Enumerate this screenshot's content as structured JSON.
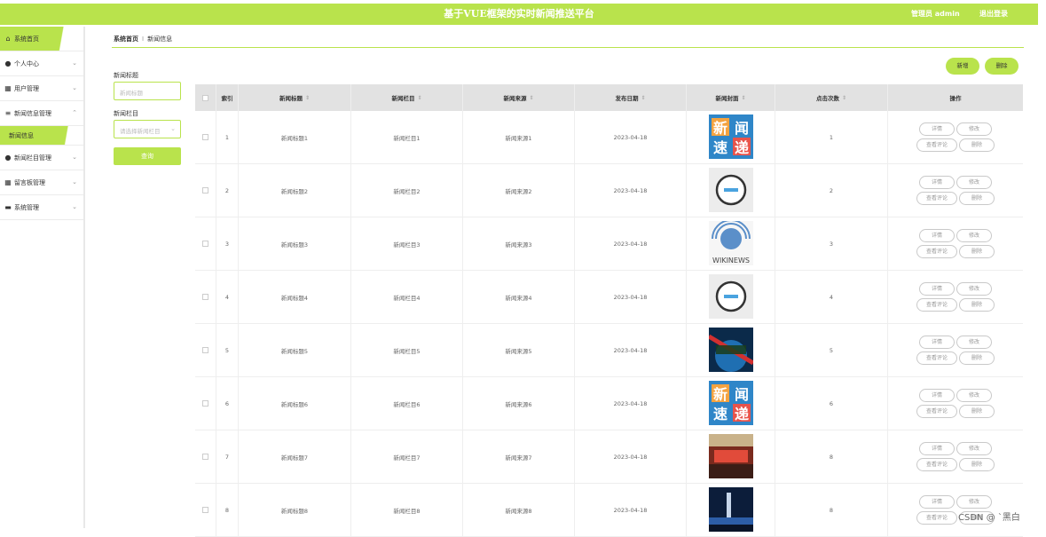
{
  "header": {
    "title": "基于VUE框架的实时新闻推送平台",
    "admin": "管理员 admin",
    "logout": "退出登录"
  },
  "sidebar": {
    "items": [
      {
        "label": "系统首页",
        "icon": "home-icon"
      },
      {
        "label": "个人中心",
        "icon": "user-icon"
      },
      {
        "label": "用户管理",
        "icon": "grid-icon"
      },
      {
        "label": "新闻信息管理",
        "icon": "list-icon"
      },
      {
        "label": "新闻信息",
        "icon": ""
      },
      {
        "label": "新闻栏目管理",
        "icon": "user-icon"
      },
      {
        "label": "留言板管理",
        "icon": "grid-icon"
      },
      {
        "label": "系统管理",
        "icon": "monitor-icon"
      }
    ]
  },
  "breadcrumb": {
    "home": "系统首页",
    "sep": "I",
    "current": "新闻信息"
  },
  "filter": {
    "title_label": "新闻标题",
    "title_placeholder": "新闻标题",
    "column_label": "新闻栏目",
    "column_placeholder": "请选择新闻栏目",
    "search_button": "查询"
  },
  "actions": {
    "add": "新增",
    "delete": "删除"
  },
  "table": {
    "headers": [
      "索引",
      "新闻标题",
      "新闻栏目",
      "新闻来源",
      "发布日期",
      "新闻封面",
      "点击次数",
      "操作"
    ],
    "rows": [
      {
        "idx": "1",
        "title": "新闻标题1",
        "column": "新闻栏目1",
        "source": "新闻来源1",
        "date": "2023-04-18",
        "clicks": "1",
        "cover": "news-flash"
      },
      {
        "idx": "2",
        "title": "新闻标题2",
        "column": "新闻栏目2",
        "source": "新闻来源2",
        "date": "2023-04-18",
        "clicks": "2",
        "cover": "circle-logo"
      },
      {
        "idx": "3",
        "title": "新闻标题3",
        "column": "新闻栏目3",
        "source": "新闻来源3",
        "date": "2023-04-18",
        "clicks": "3",
        "cover": "wikinews"
      },
      {
        "idx": "4",
        "title": "新闻标题4",
        "column": "新闻栏目4",
        "source": "新闻来源4",
        "date": "2023-04-18",
        "clicks": "4",
        "cover": "circle-logo"
      },
      {
        "idx": "5",
        "title": "新闻标题5",
        "column": "新闻栏目5",
        "source": "新闻来源5",
        "date": "2023-04-18",
        "clicks": "5",
        "cover": "globe"
      },
      {
        "idx": "6",
        "title": "新闻标题6",
        "column": "新闻栏目6",
        "source": "新闻来源6",
        "date": "2023-04-18",
        "clicks": "6",
        "cover": "news-flash"
      },
      {
        "idx": "7",
        "title": "新闻标题7",
        "column": "新闻栏目7",
        "source": "新闻来源7",
        "date": "2023-04-18",
        "clicks": "8",
        "cover": "studio"
      },
      {
        "idx": "8",
        "title": "新闻标题8",
        "column": "新闻栏目8",
        "source": "新闻来源8",
        "date": "2023-04-18",
        "clicks": "8",
        "cover": "night-city"
      }
    ],
    "ops": {
      "detail": "详情",
      "edit": "修改",
      "comments": "查看评论",
      "delete": "删除"
    }
  },
  "watermark": "CSDN @ `黑白",
  "colors": {
    "accent": "#b9e34c",
    "header_bg": "#e2e2e2"
  }
}
